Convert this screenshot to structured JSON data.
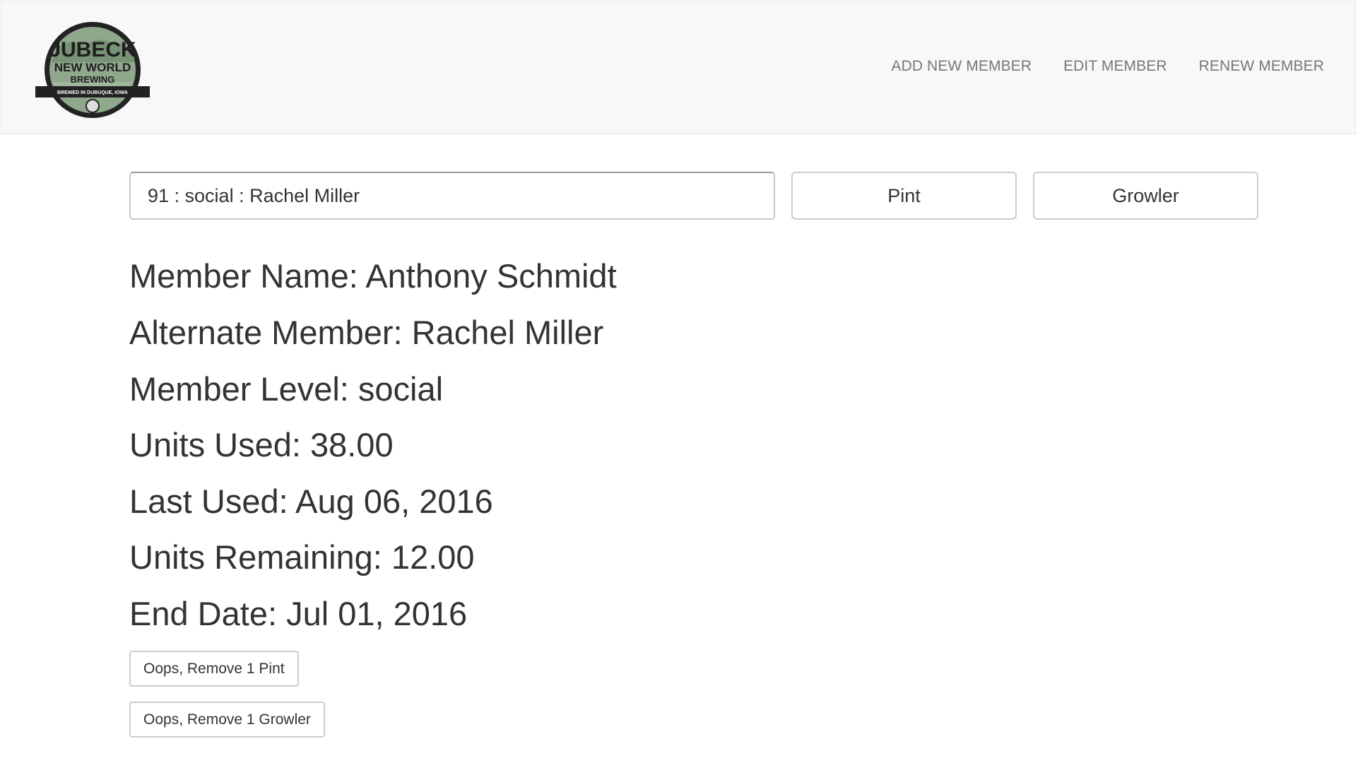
{
  "header": {
    "logo": {
      "line1": "JUBECK",
      "line2": "NEW WORLD",
      "line3": "BREWING",
      "banner": "BREWED IN DUBUQUE, IOWA"
    },
    "nav": [
      {
        "label": "ADD NEW MEMBER"
      },
      {
        "label": "EDIT MEMBER"
      },
      {
        "label": "RENEW MEMBER"
      }
    ]
  },
  "search": {
    "value": "91 : social : Rachel Miller"
  },
  "actions": {
    "pint_label": "Pint",
    "growler_label": "Growler"
  },
  "member": {
    "name": "Member Name: Anthony Schmidt",
    "alternate": "Alternate Member: Rachel Miller",
    "level": "Member Level: social",
    "units_used": "Units Used: 38.00",
    "last_used": "Last Used: Aug 06, 2016",
    "units_remaining": "Units Remaining: 12.00",
    "end_date": "End Date: Jul 01, 2016"
  },
  "corrections": {
    "remove_pint_label": "Oops, Remove 1 Pint",
    "remove_growler_label": "Oops, Remove 1 Growler"
  },
  "colors": {
    "navbar_bg": "#f8f8f8",
    "nav_link": "#777777",
    "text": "#333333",
    "logo_dark": "#222222",
    "logo_camo": "#8fa88c"
  }
}
